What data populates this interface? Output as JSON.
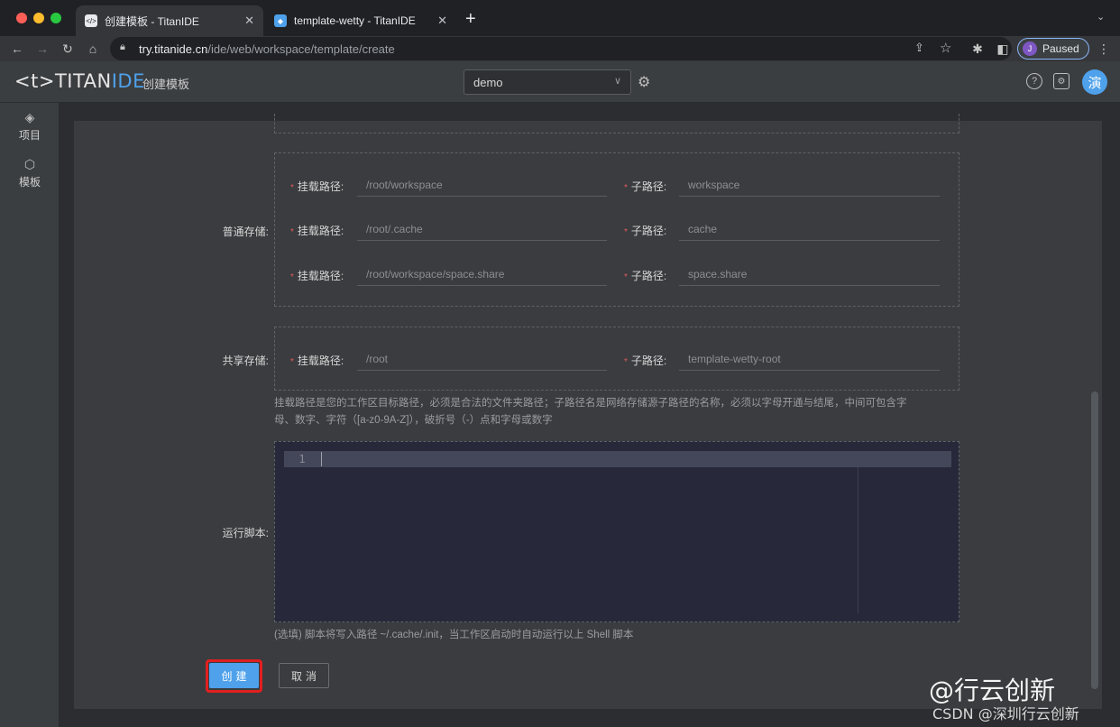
{
  "browser": {
    "tabs": [
      {
        "title": "创建模板 - TitanIDE",
        "icon": "titan-icon",
        "active": true
      },
      {
        "title": "template-wetty - TitanIDE",
        "icon": "cube-icon",
        "active": false
      }
    ],
    "url_host": "try.titanide.cn",
    "url_path": "/ide/web/workspace/template/create",
    "profile_initial": "J",
    "profile_status": "Paused"
  },
  "app": {
    "logo_left": "<t>",
    "logo_brand": "TITAN",
    "logo_accent": "IDE",
    "page_title": "创建模板",
    "workspace_select": "demo",
    "user_avatar": "演",
    "accent_color": "#4ea1ea"
  },
  "sidebar": {
    "items": [
      {
        "label": "项目",
        "icon": "layers-icon"
      },
      {
        "label": "模板",
        "icon": "box-icon"
      }
    ]
  },
  "form": {
    "normal_storage": {
      "label": "普通存储:",
      "rows": [
        {
          "mount_label": "挂载路径:",
          "mount_value": "/root/workspace",
          "sub_label": "子路径:",
          "sub_value": "workspace"
        },
        {
          "mount_label": "挂载路径:",
          "mount_value": "/root/.cache",
          "sub_label": "子路径:",
          "sub_value": "cache"
        },
        {
          "mount_label": "挂载路径:",
          "mount_value": "/root/workspace/space.share",
          "sub_label": "子路径:",
          "sub_value": "space.share"
        }
      ]
    },
    "shared_storage": {
      "label": "共享存储:",
      "rows": [
        {
          "mount_label": "挂载路径:",
          "mount_value": "/root",
          "sub_label": "子路径:",
          "sub_value": "template-wetty-root"
        }
      ]
    },
    "storage_hint_line1": "挂载路径是您的工作区目标路径，必须是合法的文件夹路径；子路径名是网络存储源子路径的名称，必须以字母开通与结尾，中间可包含字",
    "storage_hint_line2": "母、数字、字符（[a-z0-9A-Z]），破折号（-）点和字母或数字",
    "script": {
      "label": "运行脚本:",
      "line_number": "1",
      "hint": "(选填) 脚本将写入路径 ~/.cache/.init，当工作区启动时自动运行以上 Shell 脚本"
    },
    "create_button": "创建",
    "cancel_button": "取消"
  },
  "watermark": {
    "line1": "@行云创新",
    "line2": "CSDN @深圳行云创新"
  }
}
